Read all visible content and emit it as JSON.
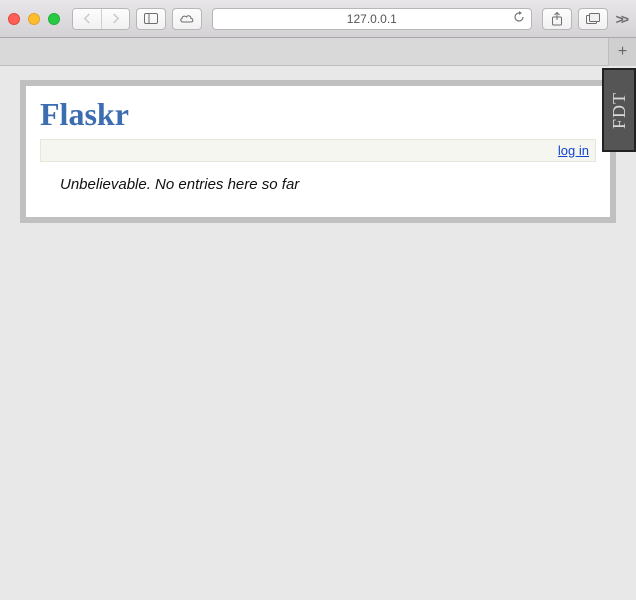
{
  "browser": {
    "address": "127.0.0.1"
  },
  "app": {
    "title": "Flaskr",
    "login_label": "log in",
    "empty_message": "Unbelievable. No entries here so far"
  },
  "badge": {
    "label": "FDT"
  }
}
